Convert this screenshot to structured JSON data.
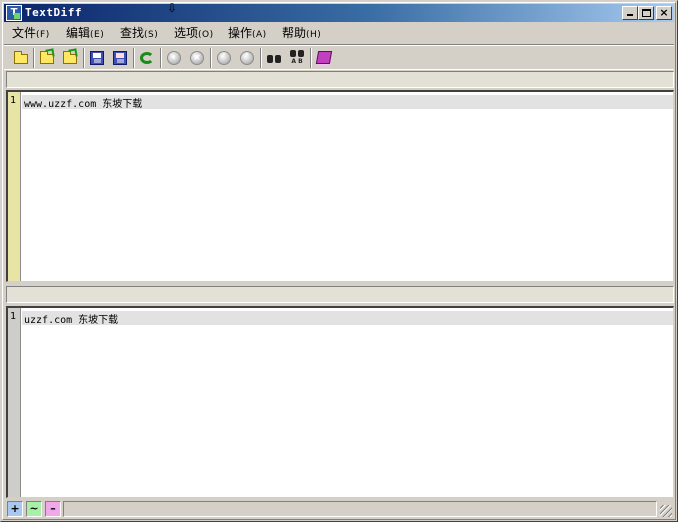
{
  "window": {
    "title": "TextDiff",
    "icon": "textdiff-app-icon"
  },
  "titlebar_buttons": {
    "minimize": "minimize",
    "maximize": "maximize",
    "close": "×"
  },
  "menu": [
    {
      "label": "文件",
      "accel": "(F)"
    },
    {
      "label": "编辑",
      "accel": "(E)"
    },
    {
      "label": "查找",
      "accel": "(S)"
    },
    {
      "label": "选项",
      "accel": "(O)"
    },
    {
      "label": "操作",
      "accel": "(A)"
    },
    {
      "label": "帮助",
      "accel": "(H)"
    }
  ],
  "toolbar": {
    "icons": [
      "new-folder-icon",
      "open-left-icon",
      "open-right-icon",
      "save-left-icon",
      "save-right-icon",
      "refresh-compare-icon",
      "prev-diff-icon",
      "next-diff-icon",
      "first-diff-icon",
      "last-diff-icon",
      "find-icon",
      "find-ab-icon",
      "help-book-icon"
    ],
    "find_ab_label": "A B"
  },
  "left_pane": {
    "lines": [
      {
        "number": "1",
        "text": "www.uzzf.com 东坡下载"
      }
    ]
  },
  "right_pane": {
    "lines": [
      {
        "number": "1",
        "text": "uzzf.com 东坡下载"
      }
    ]
  },
  "statusbar": {
    "added": "+",
    "changed": "~",
    "deleted": "–",
    "colors": {
      "added": "#a8c8f0",
      "changed": "#a8f0a8",
      "deleted": "#f0a8e8"
    }
  },
  "colors": {
    "titlebar_start": "#0a246a",
    "titlebar_end": "#a6caf0",
    "left_gutter": "#e8e4a6",
    "right_gutter": "#cfcdc9",
    "line_highlight": "#e2e2e2"
  }
}
